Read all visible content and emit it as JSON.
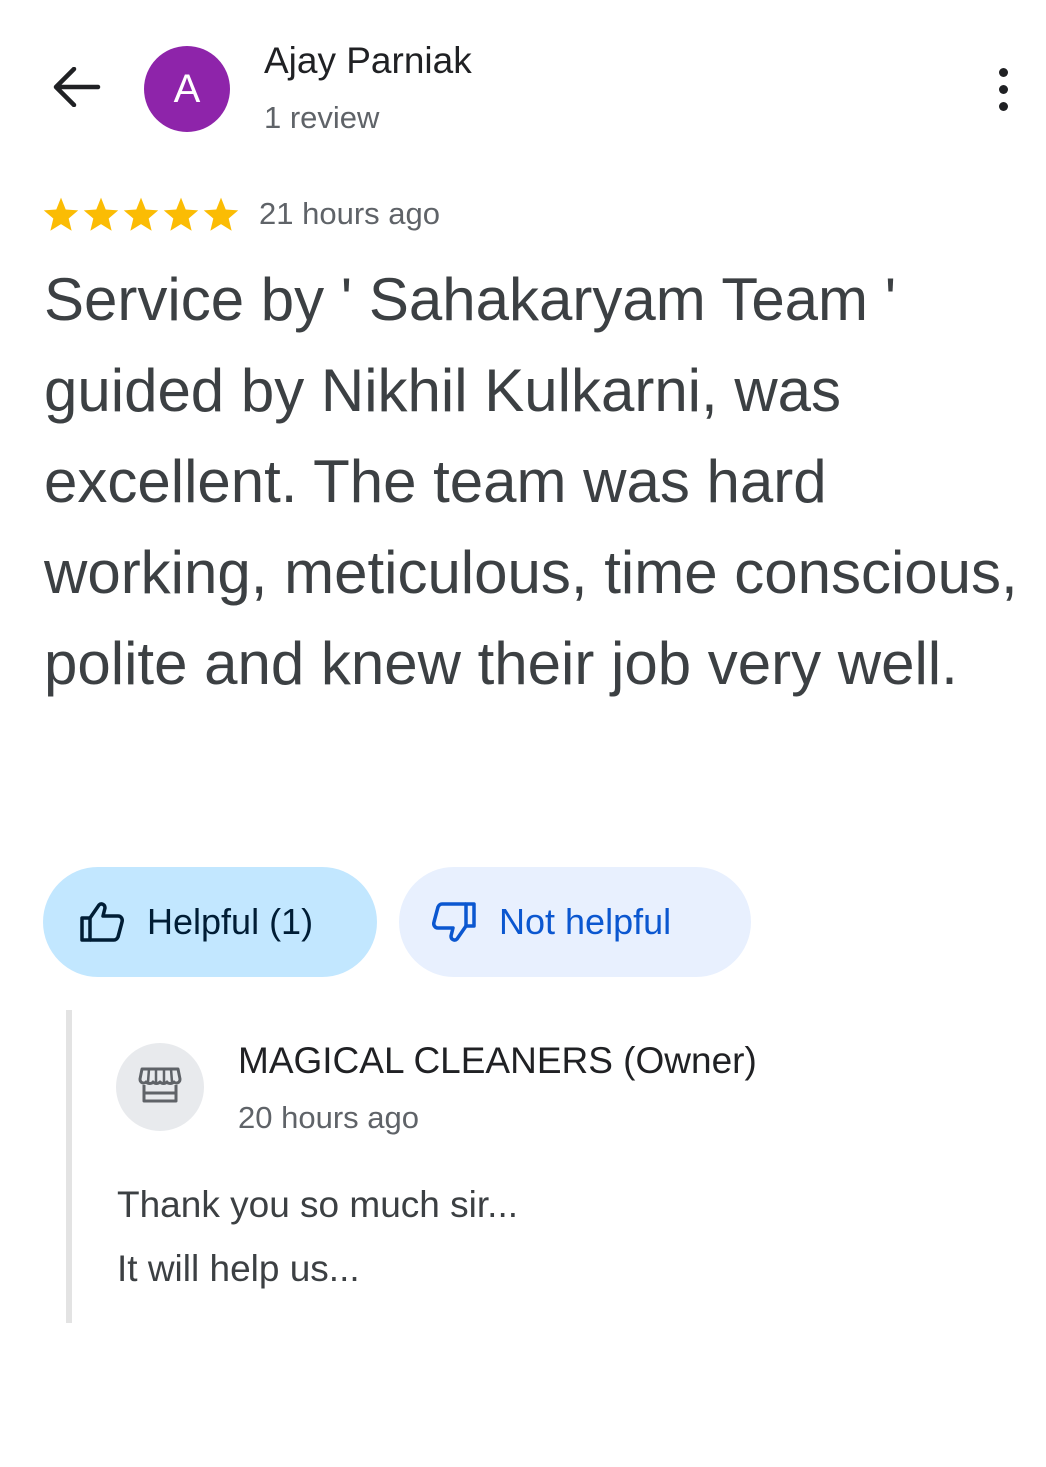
{
  "header": {
    "back_icon": "arrow-back-icon",
    "avatar_initial": "A",
    "avatar_color": "#8e24aa",
    "reviewer_name": "Ajay Parniak",
    "review_count": "1 review",
    "more_icon": "more-vert-icon"
  },
  "review": {
    "rating": 5,
    "max_rating": 5,
    "star_color": "#fbbc04",
    "time": "21 hours ago",
    "text": "Service by ' Sahakaryam Team ' guided by Nikhil Kulkarni, was excellent. The team was hard working, meticulous, time conscious, polite and knew their job very well."
  },
  "actions": {
    "helpful_label": "Helpful (1)",
    "helpful_icon": "thumb-up-icon",
    "not_helpful_label": "Not helpful",
    "not_helpful_icon": "thumb-down-icon"
  },
  "owner_response": {
    "icon": "storefront-icon",
    "name": "MAGICAL CLEANERS (Owner)",
    "time": "20 hours ago",
    "lines": [
      "Thank you so much sir...",
      "It will help us..."
    ]
  }
}
